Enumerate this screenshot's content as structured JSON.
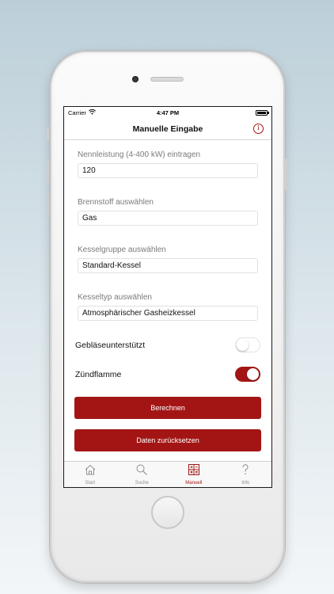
{
  "status": {
    "carrier": "Carrier",
    "time": "4:47 PM"
  },
  "navbar": {
    "title": "Manuelle Eingabe",
    "info_icon": "i"
  },
  "fields": [
    {
      "label": "Nennleistung (4-400 kW) eintragen",
      "value": "120"
    },
    {
      "label": "Brennstoff auswählen",
      "value": "Gas"
    },
    {
      "label": "Kesselgruppe auswählen",
      "value": "Standard-Kessel"
    },
    {
      "label": "Kesseltyp auswählen",
      "value": "Atmosphärischer Gasheizkessel"
    }
  ],
  "toggles": [
    {
      "label": "Gebläseunterstützt",
      "on": false
    },
    {
      "label": "Zündflamme",
      "on": true
    }
  ],
  "buttons": {
    "calculate": "Berechnen",
    "reset": "Daten zurücksetzen"
  },
  "tabs": [
    {
      "label": "Start",
      "icon": "home-icon"
    },
    {
      "label": "Suche",
      "icon": "search-icon"
    },
    {
      "label": "Manuell",
      "icon": "calculator-icon",
      "active": true
    },
    {
      "label": "Info",
      "icon": "question-icon"
    }
  ],
  "colors": {
    "accent": "#a31515"
  }
}
